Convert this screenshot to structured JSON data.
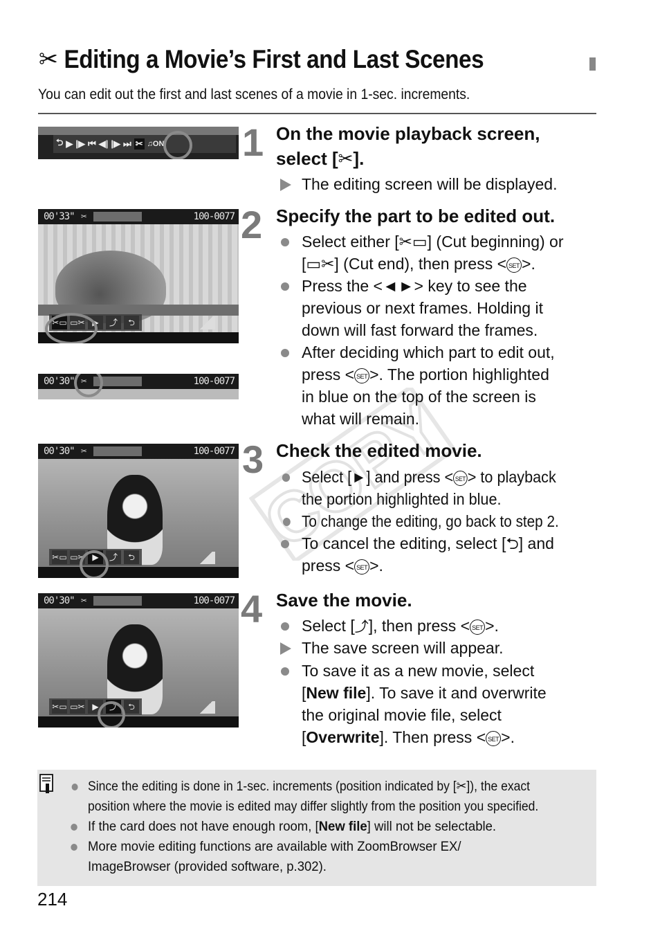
{
  "header": {
    "title_icon": "scissors-icon",
    "title": "Editing a Movie’s First and Last Scenes",
    "intro": "You can edit out the first and last scenes of a movie in 1-sec. increments."
  },
  "steps": [
    {
      "number": "1",
      "heading_line1": "On the movie playback screen,",
      "heading_line2_pre": "select [",
      "heading_line2_post": "].",
      "items": [
        {
          "type": "result",
          "text": "The editing screen will be displayed."
        }
      ]
    },
    {
      "number": "2",
      "heading": "Specify the part to be edited out.",
      "items": [
        {
          "type": "bullet",
          "lines": [
            "Select either [✂▭] (Cut beginning) or",
            "[▭✂] (Cut end), then press <",
            ">."
          ]
        },
        {
          "type": "bullet",
          "lines": [
            "Press the <◄►> key to see the",
            "previous or next frames. Holding it",
            "down will fast forward the frames."
          ]
        },
        {
          "type": "bullet",
          "lines": [
            "After deciding which part to edit out,",
            "press <",
            ">. The portion highlighted",
            "in blue on the top of the screen is",
            "what will remain."
          ]
        }
      ]
    },
    {
      "number": "3",
      "heading": "Check the edited movie.",
      "items": [
        {
          "type": "bullet",
          "lines": [
            "Select [►] and press <",
            "> to playback",
            "the portion highlighted in blue."
          ]
        },
        {
          "type": "bullet",
          "lines": [
            "To change the editing, go back to step 2."
          ]
        },
        {
          "type": "bullet",
          "lines": [
            "To cancel the editing, select [⮌] and",
            "press <",
            ">."
          ]
        }
      ]
    },
    {
      "number": "4",
      "heading": "Save the movie.",
      "items": [
        {
          "type": "bullet",
          "lines": [
            "Select [",
            "], then press <",
            ">."
          ]
        },
        {
          "type": "result",
          "text": "The save screen will appear."
        },
        {
          "type": "bullet",
          "lines": [
            "To save it as a new movie, select",
            "[",
            "New file",
            "]. To save it and overwrite",
            "the original movie file, select",
            "[",
            "Overwrite",
            "]. Then press <",
            ">."
          ]
        }
      ]
    }
  ],
  "set_button_label": "SET",
  "screens": {
    "playback_bar": {
      "controls": [
        "↶",
        "▶",
        "⏵",
        "⏮",
        "◀|",
        "|▶",
        "⏭",
        "✂",
        "♫ON"
      ],
      "selected": "✂"
    },
    "edit_screen_1": {
      "time": "00'33\"",
      "file": "100-0077",
      "selected": "cut-beginning"
    },
    "edit_screen_2": {
      "time": "00'30\"",
      "file": "100-0077",
      "selected": "scissors"
    },
    "edit_screen_3": {
      "time": "00'30\"",
      "file": "100-0077",
      "selected": "play"
    },
    "edit_screen_4": {
      "time": "00'30\"",
      "file": "100-0077",
      "selected": "save"
    },
    "edit_controls": [
      "✂▭",
      "▭✂",
      "▶",
      "⤴",
      "↶"
    ]
  },
  "notes": {
    "icon": "note-pencil-icon",
    "items": [
      {
        "lines": [
          "Since the editing is done in 1-sec. increments (position indicated by [",
          "]), the exact",
          "position where the movie is edited may differ slightly from the position you specified."
        ]
      },
      {
        "lines": [
          "If the card does not have enough room, [",
          "New file",
          "] will not be selectable."
        ]
      },
      {
        "lines": [
          "More movie editing functions are available with ZoomBrowser EX/",
          "ImageBrowser (provided software, p.302)."
        ]
      }
    ]
  },
  "watermark": "COPY",
  "page_number": "214"
}
